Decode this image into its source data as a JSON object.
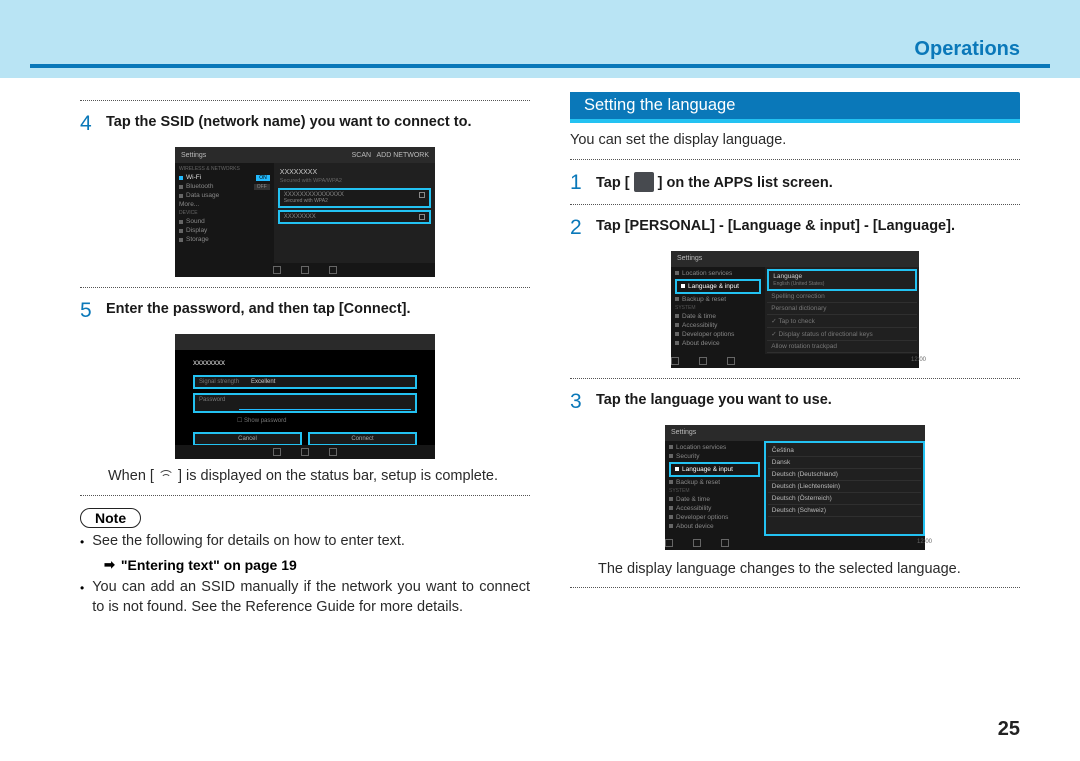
{
  "header": {
    "title": "Operations"
  },
  "left": {
    "step4": {
      "num": "4",
      "text": "Tap the SSID (network name) you want to connect to."
    },
    "shotA": {
      "title": "Settings",
      "side": [
        "WIRELESS & NETWORKS",
        "Wi-Fi",
        "Bluetooth",
        "Data usage",
        "More...",
        "DEVICE",
        "Sound",
        "Display",
        "Storage"
      ],
      "rows": [
        {
          "ssid": "XXXXXXXX",
          "sub": "Secured with WPA/WPA2"
        },
        {
          "ssid": "XXXXXXXXXXXXXXX",
          "sub": "Secured with WPA2"
        },
        {
          "ssid": "XXXXXXXX",
          "sub": ""
        }
      ]
    },
    "step5": {
      "num": "5",
      "text": "Enter the password, and then tap [Connect]."
    },
    "shotB": {
      "ssid": "xxxxxxxx",
      "strength_label": "Signal strength",
      "strength_val": "Excellent",
      "pw_label": "Password",
      "show": "Show password",
      "cancel": "Cancel",
      "connect": "Connect"
    },
    "status_pre": "When [ ",
    "status_post": " ] is displayed on the status bar, setup is complete.",
    "note": "Note",
    "bul1": "See the following for details on how to enter text.",
    "link": "\"Entering text\" on page 19",
    "bul2": "You can add an SSID manually if the network you want to connect to is not found. See the Reference Guide for more details."
  },
  "right": {
    "section": "Setting the language",
    "intro": "You can set the display language.",
    "step1": {
      "num": "1",
      "pre": "Tap [ ",
      "post": " ] on the APPS list screen."
    },
    "step2": {
      "num": "2",
      "text": "Tap [PERSONAL] - [Language & input] - [Language]."
    },
    "shotC": {
      "title": "Settings",
      "side": [
        "Location services",
        "Language & input",
        "Backup & reset",
        "SYSTEM",
        "Date & time",
        "Accessibility",
        "Developer options",
        "About device"
      ],
      "rows": [
        "Language",
        "Spelling correction",
        "Personal dictionary",
        "Tap to check",
        "Display status of directional keys",
        "Allow rotation trackpad"
      ],
      "lang_sub": "English (United States)"
    },
    "step3": {
      "num": "3",
      "text": "Tap the language you want to use."
    },
    "shotD": {
      "title": "Settings",
      "side": [
        "Location services",
        "Security",
        "Language & input",
        "Backup & reset",
        "SYSTEM",
        "Date & time",
        "Accessibility",
        "Developer options",
        "About device"
      ],
      "langs": [
        "Čeština",
        "Dansk",
        "Deutsch (Deutschland)",
        "Deutsch (Liechtenstein)",
        "Deutsch (Österreich)",
        "Deutsch (Schweiz)"
      ]
    },
    "outro": "The display language changes to the selected language."
  },
  "page": "25"
}
